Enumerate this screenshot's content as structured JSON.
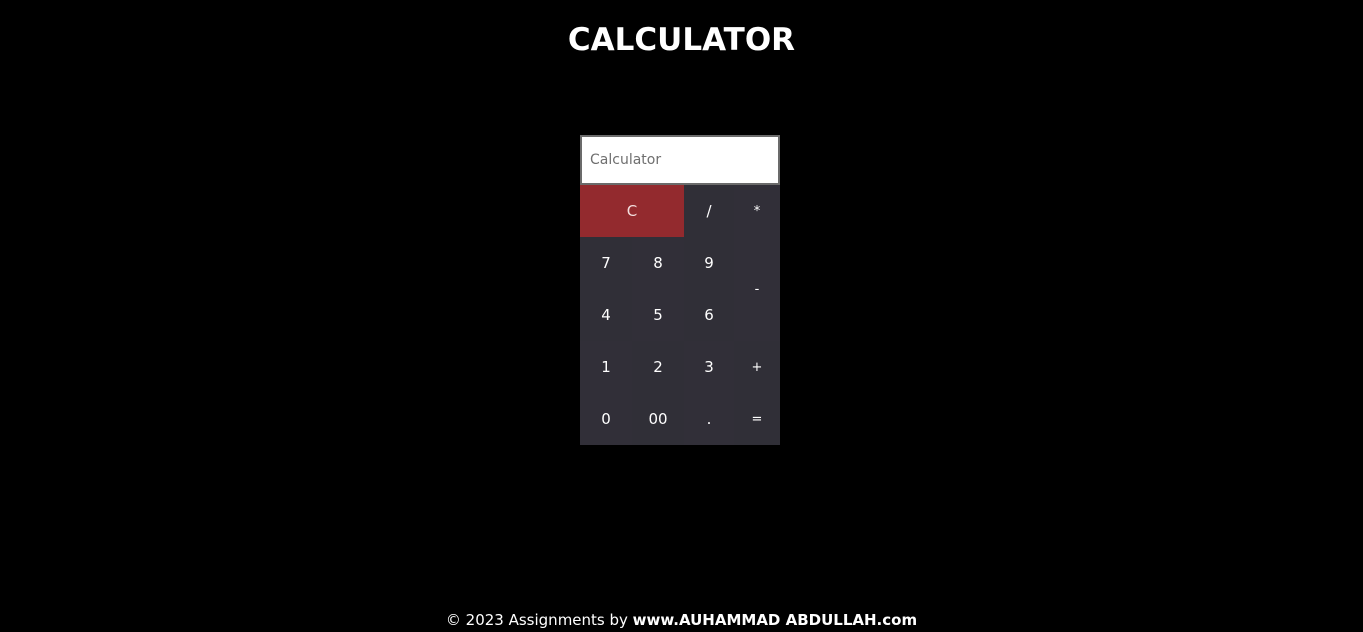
{
  "header": {
    "title": "CALCULATOR"
  },
  "calculator": {
    "display": {
      "value": "",
      "placeholder": "Calculator"
    },
    "keys": {
      "clear": "C",
      "divide": "/",
      "multiply": "*",
      "seven": "7",
      "eight": "8",
      "nine": "9",
      "minus": "-",
      "four": "4",
      "five": "5",
      "six": "6",
      "one": "1",
      "two": "2",
      "three": "3",
      "plus": "+",
      "zero": "0",
      "double_zero": "00",
      "decimal": ".",
      "equals": "="
    }
  },
  "footer": {
    "prefix": "© 2023 Assignments by ",
    "author": "www.AUHAMMAD ABDULLAH.com"
  },
  "colors": {
    "background": "#000000",
    "keypad": "#302f37",
    "clear_button": "#932a2e",
    "text": "#ffffff"
  }
}
